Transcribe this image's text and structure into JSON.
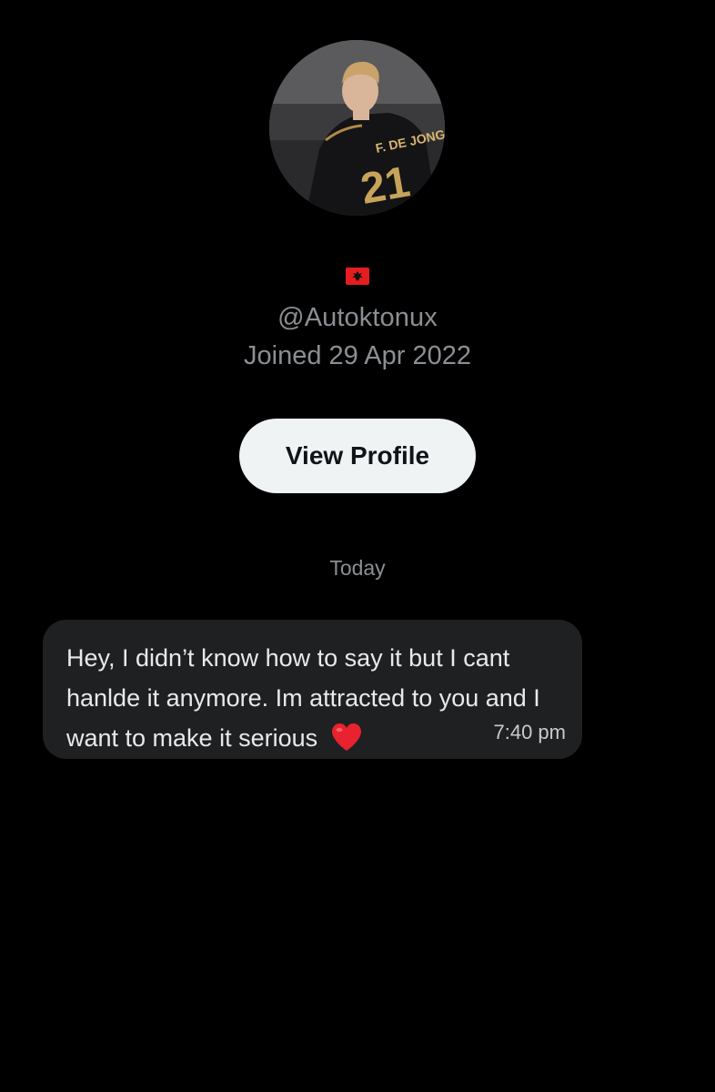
{
  "profile": {
    "flag_icon": "albania-flag-icon",
    "handle": "@Autoktonux",
    "joined": "Joined 29 Apr 2022",
    "view_profile_label": "View Profile",
    "avatar_jersey_text": "F. DE JONG",
    "avatar_jersey_number": "21"
  },
  "conversation": {
    "date_divider": "Today",
    "messages": [
      {
        "text": "Hey, I didn’t know how to say it but I cant hanlde it anymore. Im attracted to you and I want to make it serious",
        "emoji_icon": "red-heart-icon",
        "time": "7:40 pm"
      }
    ]
  },
  "colors": {
    "background": "#000000",
    "secondary_text": "#8b8f93",
    "button_bg": "#eff3f4",
    "button_text": "#0f1419",
    "bubble_bg": "#1f2022",
    "heart": "#e8222e"
  }
}
